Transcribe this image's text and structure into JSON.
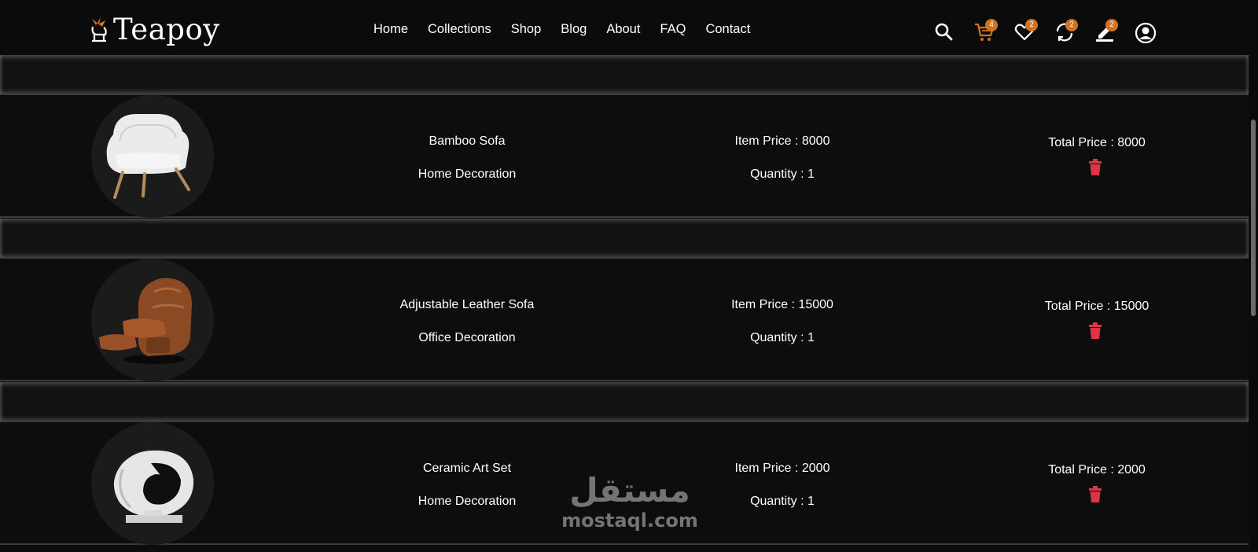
{
  "header": {
    "logo_text": "Teapoy",
    "nav": [
      "Home",
      "Collections",
      "Shop",
      "Blog",
      "About",
      "FAQ",
      "Contact"
    ],
    "icons": [
      {
        "name": "search-icon",
        "badge": null,
        "color": "#ffffff"
      },
      {
        "name": "cart-icon",
        "badge": "4",
        "color": "#d1731f"
      },
      {
        "name": "heart-icon",
        "badge": "2",
        "color": "#ffffff"
      },
      {
        "name": "compare-icon",
        "badge": "2",
        "color": "#ffffff"
      },
      {
        "name": "edit-icon",
        "badge": "2",
        "color": "#ffffff"
      },
      {
        "name": "user-icon",
        "badge": null,
        "color": "#ffffff"
      }
    ]
  },
  "cart": {
    "items": [
      {
        "name": "Bamboo Sofa",
        "category": "Home Decoration",
        "item_price": "Item Price : 8000",
        "quantity": "Quantity : 1",
        "total": "Total Price : 8000",
        "image": "white-armchair"
      },
      {
        "name": "Adjustable Leather Sofa",
        "category": "Office Decoration",
        "item_price": "Item Price : 15000",
        "quantity": "Quantity : 1",
        "total": "Total Price : 15000",
        "image": "brown-recliner"
      },
      {
        "name": "Ceramic Art Set",
        "category": "Home Decoration",
        "item_price": "Item Price : 2000",
        "quantity": "Quantity : 1",
        "total": "Total Price : 2000",
        "image": "ceramic-sculpture"
      }
    ],
    "delete_icon": "trash-icon",
    "delete_color": "#dc3545"
  },
  "watermark": {
    "arabic": "مستقل",
    "latin": "mostaql.com"
  },
  "colors": {
    "accent": "#d1731f",
    "background": "#0d0d0d",
    "danger": "#dc3545"
  }
}
